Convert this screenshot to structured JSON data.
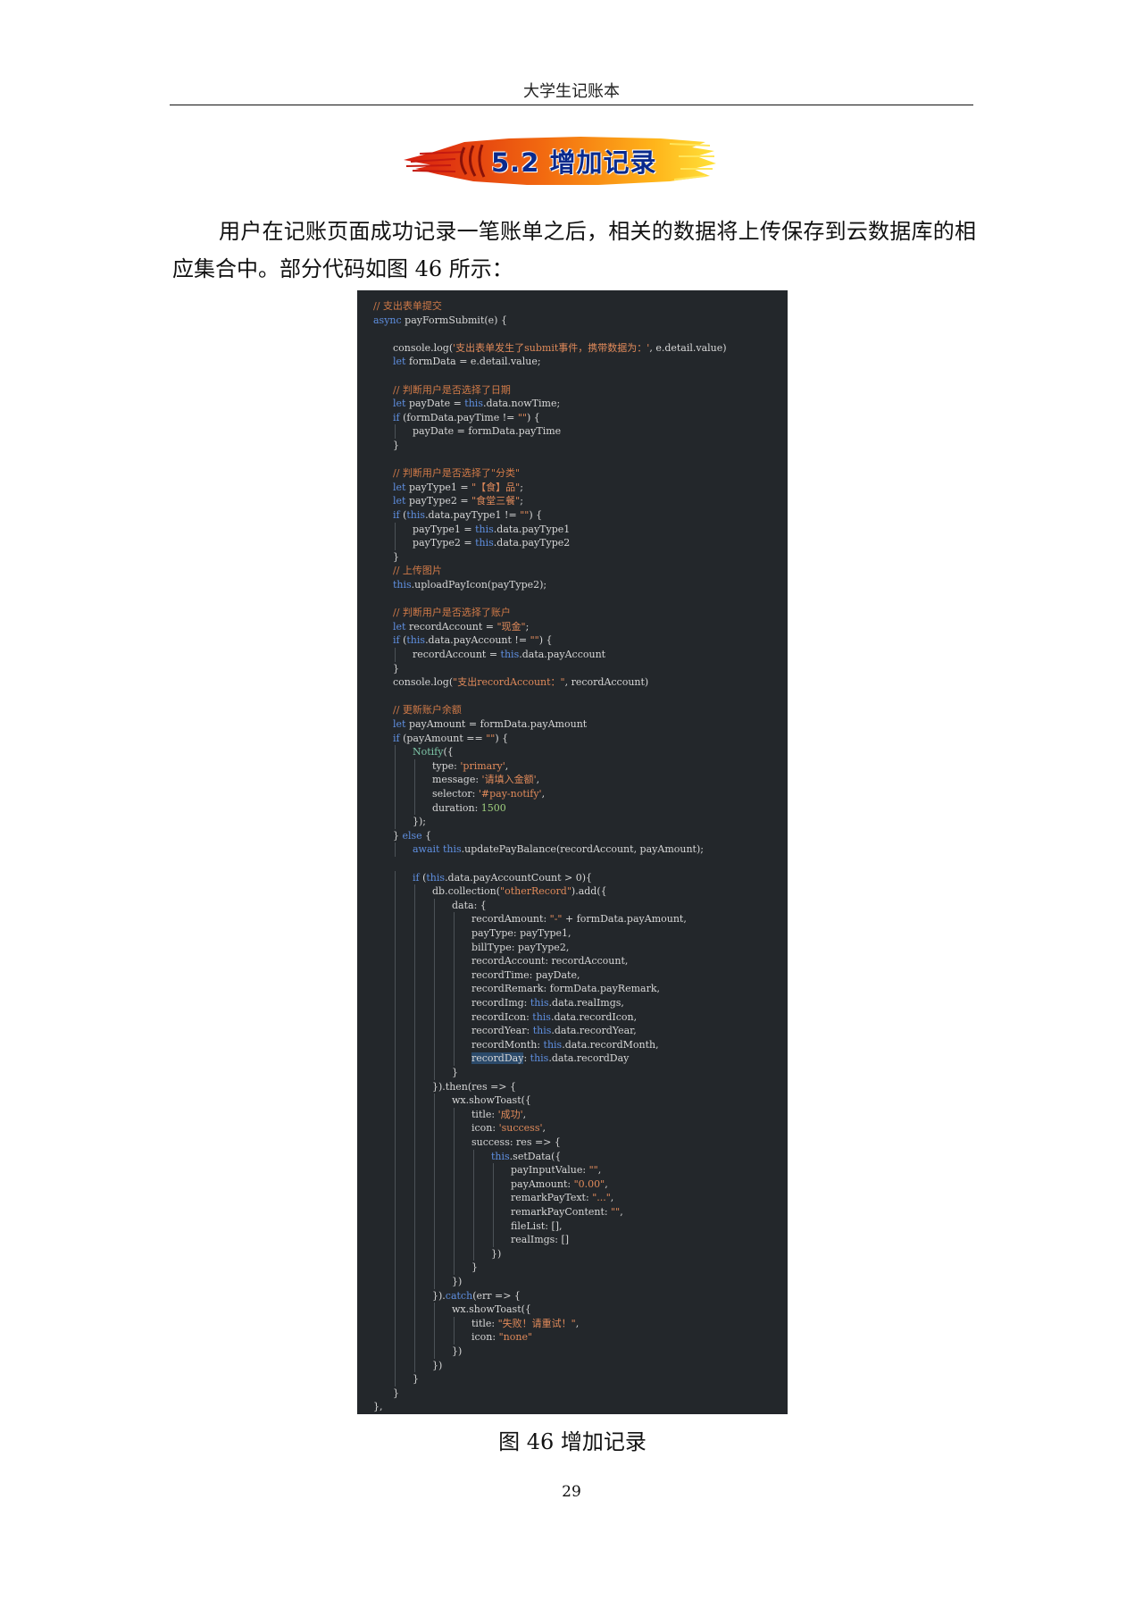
{
  "header": {
    "title": "大学生记账本"
  },
  "section": {
    "title": "5.2 增加记录"
  },
  "paragraph": "用户在记账页面成功记录一笔账单之后，相关的数据将上传保存到云数据库的相应集合中。部分代码如图 46 所示：",
  "code": {
    "lines": [
      {
        "indent": 0,
        "segments": [
          {
            "t": "// 支出表单提交",
            "c": "cmt"
          }
        ]
      },
      {
        "indent": 0,
        "segments": [
          {
            "t": "async ",
            "c": "kw"
          },
          {
            "t": "payFormSubmit(e) {",
            "c": ""
          }
        ]
      },
      {
        "indent": 0,
        "segments": []
      },
      {
        "indent": 1,
        "segments": [
          {
            "t": "console.log(",
            "c": ""
          },
          {
            "t": "'支出表单发生了submit事件，携带数据为：'",
            "c": "str"
          },
          {
            "t": ", e.detail.value)",
            "c": ""
          }
        ]
      },
      {
        "indent": 1,
        "segments": [
          {
            "t": "let ",
            "c": "kw"
          },
          {
            "t": "formData = e.detail.value;",
            "c": ""
          }
        ]
      },
      {
        "indent": 0,
        "segments": []
      },
      {
        "indent": 1,
        "segments": [
          {
            "t": "// 判断用户是否选择了日期",
            "c": "cmt"
          }
        ]
      },
      {
        "indent": 1,
        "segments": [
          {
            "t": "let ",
            "c": "kw"
          },
          {
            "t": "payDate = ",
            "c": ""
          },
          {
            "t": "this",
            "c": "kw"
          },
          {
            "t": ".data.nowTime;",
            "c": ""
          }
        ]
      },
      {
        "indent": 1,
        "segments": [
          {
            "t": "if ",
            "c": "kw"
          },
          {
            "t": "(formData.payTime != ",
            "c": ""
          },
          {
            "t": "\"\"",
            "c": "str"
          },
          {
            "t": ") {",
            "c": ""
          }
        ]
      },
      {
        "indent": 2,
        "segments": [
          {
            "t": "payDate = formData.payTime",
            "c": ""
          }
        ]
      },
      {
        "indent": 1,
        "segments": [
          {
            "t": "}",
            "c": ""
          }
        ]
      },
      {
        "indent": 0,
        "segments": []
      },
      {
        "indent": 1,
        "segments": [
          {
            "t": "// 判断用户是否选择了\"分类\"",
            "c": "cmt"
          }
        ]
      },
      {
        "indent": 1,
        "segments": [
          {
            "t": "let ",
            "c": "kw"
          },
          {
            "t": "payType1 = ",
            "c": ""
          },
          {
            "t": "\"【食】品\"",
            "c": "str"
          },
          {
            "t": ";",
            "c": ""
          }
        ]
      },
      {
        "indent": 1,
        "segments": [
          {
            "t": "let ",
            "c": "kw"
          },
          {
            "t": "payType2 = ",
            "c": ""
          },
          {
            "t": "\"食堂三餐\"",
            "c": "str"
          },
          {
            "t": ";",
            "c": ""
          }
        ]
      },
      {
        "indent": 1,
        "segments": [
          {
            "t": "if ",
            "c": "kw"
          },
          {
            "t": "(",
            "c": ""
          },
          {
            "t": "this",
            "c": "kw"
          },
          {
            "t": ".data.payType1 != ",
            "c": ""
          },
          {
            "t": "\"\"",
            "c": "str"
          },
          {
            "t": ") {",
            "c": ""
          }
        ]
      },
      {
        "indent": 2,
        "segments": [
          {
            "t": "payType1 = ",
            "c": ""
          },
          {
            "t": "this",
            "c": "kw"
          },
          {
            "t": ".data.payType1",
            "c": ""
          }
        ]
      },
      {
        "indent": 2,
        "segments": [
          {
            "t": "payType2 = ",
            "c": ""
          },
          {
            "t": "this",
            "c": "kw"
          },
          {
            "t": ".data.payType2",
            "c": ""
          }
        ]
      },
      {
        "indent": 1,
        "segments": [
          {
            "t": "}",
            "c": ""
          }
        ]
      },
      {
        "indent": 1,
        "segments": [
          {
            "t": "// 上传图片",
            "c": "cmt"
          }
        ]
      },
      {
        "indent": 1,
        "segments": [
          {
            "t": "this",
            "c": "kw"
          },
          {
            "t": ".uploadPayIcon(payType2);",
            "c": ""
          }
        ]
      },
      {
        "indent": 0,
        "segments": []
      },
      {
        "indent": 1,
        "segments": [
          {
            "t": "// 判断用户是否选择了账户",
            "c": "cmt"
          }
        ]
      },
      {
        "indent": 1,
        "segments": [
          {
            "t": "let ",
            "c": "kw"
          },
          {
            "t": "recordAccount = ",
            "c": ""
          },
          {
            "t": "\"现金\"",
            "c": "str"
          },
          {
            "t": ";",
            "c": ""
          }
        ]
      },
      {
        "indent": 1,
        "segments": [
          {
            "t": "if ",
            "c": "kw"
          },
          {
            "t": "(",
            "c": ""
          },
          {
            "t": "this",
            "c": "kw"
          },
          {
            "t": ".data.payAccount != ",
            "c": ""
          },
          {
            "t": "\"\"",
            "c": "str"
          },
          {
            "t": ") {",
            "c": ""
          }
        ]
      },
      {
        "indent": 2,
        "segments": [
          {
            "t": "recordAccount = ",
            "c": ""
          },
          {
            "t": "this",
            "c": "kw"
          },
          {
            "t": ".data.payAccount",
            "c": ""
          }
        ]
      },
      {
        "indent": 1,
        "segments": [
          {
            "t": "}",
            "c": ""
          }
        ]
      },
      {
        "indent": 1,
        "segments": [
          {
            "t": "console.log(",
            "c": ""
          },
          {
            "t": "\"支出recordAccount：\"",
            "c": "str"
          },
          {
            "t": ", recordAccount)",
            "c": ""
          }
        ]
      },
      {
        "indent": 0,
        "segments": []
      },
      {
        "indent": 1,
        "segments": [
          {
            "t": "// 更新账户余额",
            "c": "cmt"
          }
        ]
      },
      {
        "indent": 1,
        "segments": [
          {
            "t": "let ",
            "c": "kw"
          },
          {
            "t": "payAmount = formData.payAmount",
            "c": ""
          }
        ]
      },
      {
        "indent": 1,
        "segments": [
          {
            "t": "if ",
            "c": "kw"
          },
          {
            "t": "(payAmount == ",
            "c": ""
          },
          {
            "t": "\"\"",
            "c": "str"
          },
          {
            "t": ") {",
            "c": ""
          }
        ]
      },
      {
        "indent": 2,
        "segments": [
          {
            "t": "Notify",
            "c": "fn"
          },
          {
            "t": "({",
            "c": ""
          }
        ]
      },
      {
        "indent": 3,
        "segments": [
          {
            "t": "type: ",
            "c": ""
          },
          {
            "t": "'primary'",
            "c": "str"
          },
          {
            "t": ",",
            "c": ""
          }
        ]
      },
      {
        "indent": 3,
        "segments": [
          {
            "t": "message: ",
            "c": ""
          },
          {
            "t": "'请填入金额'",
            "c": "str"
          },
          {
            "t": ",",
            "c": ""
          }
        ]
      },
      {
        "indent": 3,
        "segments": [
          {
            "t": "selector: ",
            "c": ""
          },
          {
            "t": "'#pay-notify'",
            "c": "str"
          },
          {
            "t": ",",
            "c": ""
          }
        ]
      },
      {
        "indent": 3,
        "segments": [
          {
            "t": "duration: ",
            "c": ""
          },
          {
            "t": "1500",
            "c": "num"
          }
        ]
      },
      {
        "indent": 2,
        "segments": [
          {
            "t": "});",
            "c": ""
          }
        ]
      },
      {
        "indent": 1,
        "segments": [
          {
            "t": "} ",
            "c": ""
          },
          {
            "t": "else",
            "c": "kw"
          },
          {
            "t": " {",
            "c": ""
          }
        ]
      },
      {
        "indent": 2,
        "segments": [
          {
            "t": "await ",
            "c": "kw"
          },
          {
            "t": "this",
            "c": "kw"
          },
          {
            "t": ".updatePayBalance(recordAccount, payAmount);",
            "c": ""
          }
        ]
      },
      {
        "indent": 0,
        "segments": []
      },
      {
        "indent": 2,
        "segments": [
          {
            "t": "if ",
            "c": "kw"
          },
          {
            "t": "(",
            "c": ""
          },
          {
            "t": "this",
            "c": "kw"
          },
          {
            "t": ".data.payAccountCount > 0){",
            "c": ""
          }
        ]
      },
      {
        "indent": 3,
        "segments": [
          {
            "t": "db.collection(",
            "c": ""
          },
          {
            "t": "\"otherRecord\"",
            "c": "str"
          },
          {
            "t": ").add({",
            "c": ""
          }
        ]
      },
      {
        "indent": 4,
        "segments": [
          {
            "t": "data: {",
            "c": ""
          }
        ]
      },
      {
        "indent": 5,
        "segments": [
          {
            "t": "recordAmount: ",
            "c": ""
          },
          {
            "t": "\"-\"",
            "c": "str"
          },
          {
            "t": " + formData.payAmount,",
            "c": ""
          }
        ]
      },
      {
        "indent": 5,
        "segments": [
          {
            "t": "payType: payType1,",
            "c": ""
          }
        ]
      },
      {
        "indent": 5,
        "segments": [
          {
            "t": "billType: payType2,",
            "c": ""
          }
        ]
      },
      {
        "indent": 5,
        "segments": [
          {
            "t": "recordAccount: recordAccount,",
            "c": ""
          }
        ]
      },
      {
        "indent": 5,
        "segments": [
          {
            "t": "recordTime: payDate,",
            "c": ""
          }
        ]
      },
      {
        "indent": 5,
        "segments": [
          {
            "t": "recordRemark: formData.payRemark,",
            "c": ""
          }
        ]
      },
      {
        "indent": 5,
        "segments": [
          {
            "t": "recordImg: ",
            "c": ""
          },
          {
            "t": "this",
            "c": "kw"
          },
          {
            "t": ".data.realImgs,",
            "c": ""
          }
        ]
      },
      {
        "indent": 5,
        "segments": [
          {
            "t": "recordIcon: ",
            "c": ""
          },
          {
            "t": "this",
            "c": "kw"
          },
          {
            "t": ".data.recordIcon,",
            "c": ""
          }
        ]
      },
      {
        "indent": 5,
        "segments": [
          {
            "t": "recordYear: ",
            "c": ""
          },
          {
            "t": "this",
            "c": "kw"
          },
          {
            "t": ".data.recordYear,",
            "c": ""
          }
        ]
      },
      {
        "indent": 5,
        "segments": [
          {
            "t": "recordMonth: ",
            "c": ""
          },
          {
            "t": "this",
            "c": "kw"
          },
          {
            "t": ".data.recordMonth,",
            "c": ""
          }
        ]
      },
      {
        "indent": 5,
        "segments": [
          {
            "t": "recordDay",
            "c": "hl"
          },
          {
            "t": ": ",
            "c": ""
          },
          {
            "t": "this",
            "c": "kw"
          },
          {
            "t": ".data.recordDay",
            "c": ""
          }
        ]
      },
      {
        "indent": 4,
        "segments": [
          {
            "t": "}",
            "c": ""
          }
        ]
      },
      {
        "indent": 3,
        "segments": [
          {
            "t": "}).then(res => {",
            "c": ""
          }
        ]
      },
      {
        "indent": 4,
        "segments": [
          {
            "t": "wx.showToast({",
            "c": ""
          }
        ]
      },
      {
        "indent": 5,
        "segments": [
          {
            "t": "title: ",
            "c": ""
          },
          {
            "t": "'成功'",
            "c": "str"
          },
          {
            "t": ",",
            "c": ""
          }
        ]
      },
      {
        "indent": 5,
        "segments": [
          {
            "t": "icon: ",
            "c": ""
          },
          {
            "t": "'success'",
            "c": "str"
          },
          {
            "t": ",",
            "c": ""
          }
        ]
      },
      {
        "indent": 5,
        "segments": [
          {
            "t": "success: res => {",
            "c": ""
          }
        ]
      },
      {
        "indent": 6,
        "segments": [
          {
            "t": "this",
            "c": "kw"
          },
          {
            "t": ".setData({",
            "c": ""
          }
        ]
      },
      {
        "indent": 7,
        "segments": [
          {
            "t": "payInputValue: ",
            "c": ""
          },
          {
            "t": "\"\"",
            "c": "str"
          },
          {
            "t": ",",
            "c": ""
          }
        ]
      },
      {
        "indent": 7,
        "segments": [
          {
            "t": "payAmount: ",
            "c": ""
          },
          {
            "t": "\"0.00\"",
            "c": "str"
          },
          {
            "t": ",",
            "c": ""
          }
        ]
      },
      {
        "indent": 7,
        "segments": [
          {
            "t": "remarkPayText: ",
            "c": ""
          },
          {
            "t": "\"...\"",
            "c": "str"
          },
          {
            "t": ",",
            "c": ""
          }
        ]
      },
      {
        "indent": 7,
        "segments": [
          {
            "t": "remarkPayContent: ",
            "c": ""
          },
          {
            "t": "\"\"",
            "c": "str"
          },
          {
            "t": ",",
            "c": ""
          }
        ]
      },
      {
        "indent": 7,
        "segments": [
          {
            "t": "fileList: [],",
            "c": ""
          }
        ]
      },
      {
        "indent": 7,
        "segments": [
          {
            "t": "realImgs: []",
            "c": ""
          }
        ]
      },
      {
        "indent": 6,
        "segments": [
          {
            "t": "})",
            "c": ""
          }
        ]
      },
      {
        "indent": 5,
        "segments": [
          {
            "t": "}",
            "c": ""
          }
        ]
      },
      {
        "indent": 4,
        "segments": [
          {
            "t": "})",
            "c": ""
          }
        ]
      },
      {
        "indent": 3,
        "segments": [
          {
            "t": "}).",
            "c": ""
          },
          {
            "t": "catch",
            "c": "kw"
          },
          {
            "t": "(err => {",
            "c": ""
          }
        ]
      },
      {
        "indent": 4,
        "segments": [
          {
            "t": "wx.showToast({",
            "c": ""
          }
        ]
      },
      {
        "indent": 5,
        "segments": [
          {
            "t": "title: ",
            "c": ""
          },
          {
            "t": "\"失败！请重试！\"",
            "c": "str"
          },
          {
            "t": ",",
            "c": ""
          }
        ]
      },
      {
        "indent": 5,
        "segments": [
          {
            "t": "icon: ",
            "c": ""
          },
          {
            "t": "\"none\"",
            "c": "str"
          }
        ]
      },
      {
        "indent": 4,
        "segments": [
          {
            "t": "})",
            "c": ""
          }
        ]
      },
      {
        "indent": 3,
        "segments": [
          {
            "t": "})",
            "c": ""
          }
        ]
      },
      {
        "indent": 2,
        "segments": [
          {
            "t": "}",
            "c": ""
          }
        ]
      },
      {
        "indent": 1,
        "segments": [
          {
            "t": "}",
            "c": ""
          }
        ]
      },
      {
        "indent": 0,
        "segments": [
          {
            "t": "},",
            "c": ""
          }
        ]
      }
    ]
  },
  "figure": {
    "caption": "图 46  增加记录"
  },
  "page": {
    "number": "29"
  }
}
